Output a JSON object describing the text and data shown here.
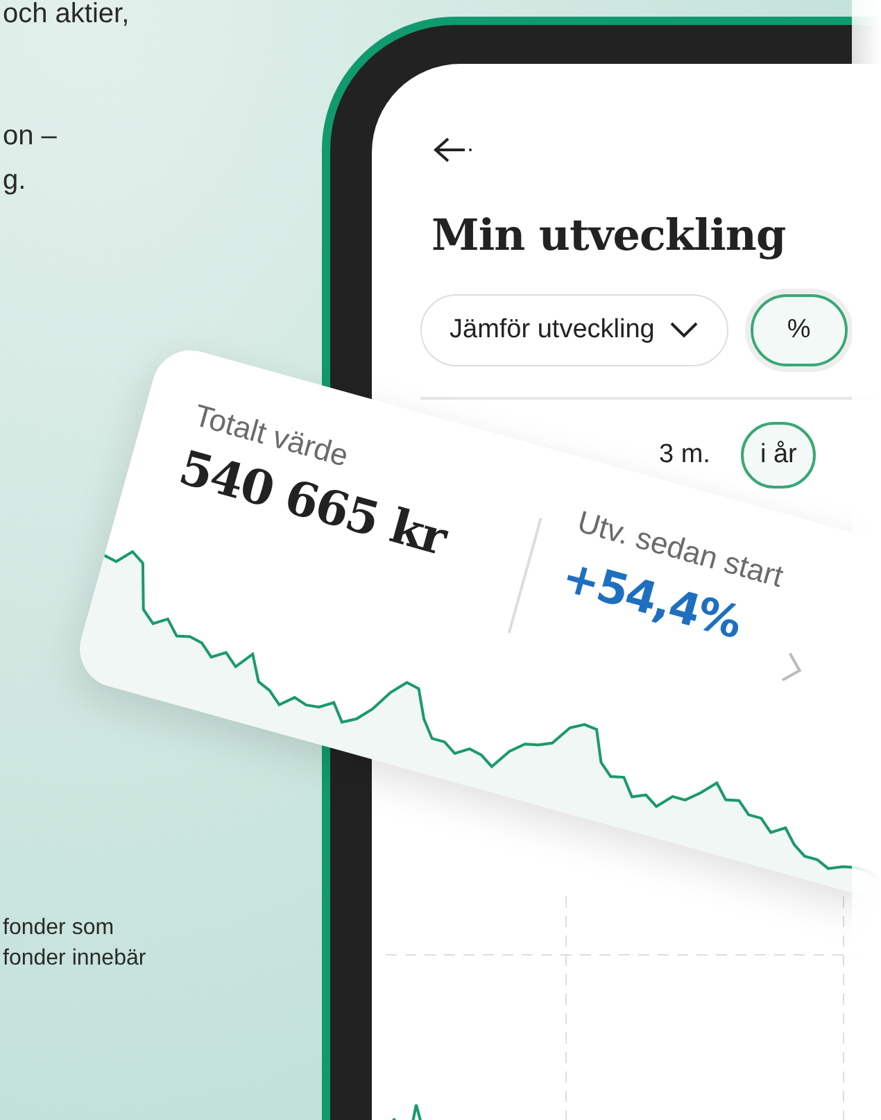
{
  "intro_text": [
    {
      "text": "och aktier,"
    },
    {
      "text": "on –"
    },
    {
      "text": "g."
    }
  ],
  "footnote_text": [
    {
      "text": "fonder som"
    },
    {
      "text": "fonder innebär"
    }
  ],
  "phone": {
    "title": "Min utveckling",
    "compare_dropdown": {
      "label": "Jämför utveckling"
    },
    "unit_toggle": {
      "label": "%",
      "selected": true
    },
    "periods": [
      {
        "label": "3 m.",
        "selected": false
      },
      {
        "label": "i år",
        "selected": true
      }
    ]
  },
  "summary_card": {
    "total_label": "Totalt värde",
    "total_value": "540 665 kr",
    "change_label": "Utv. sedan start",
    "change_value": "+54,4%"
  }
}
